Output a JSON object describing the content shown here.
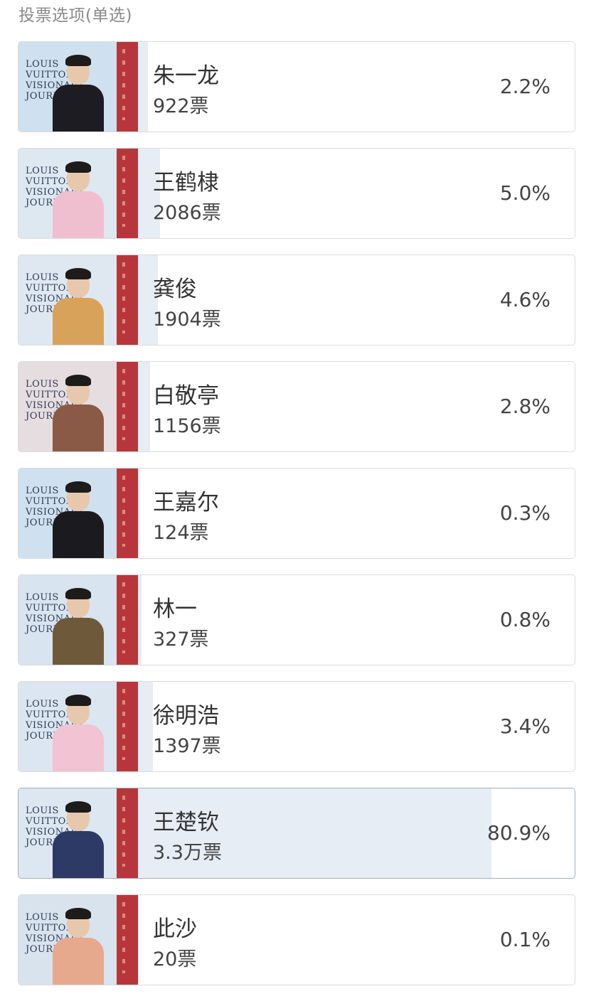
{
  "poll": {
    "header": "投票选项(单选)",
    "brand_text": "LOUIS VUITTON VISIONARY JOURNEYS",
    "options": [
      {
        "name": "朱一龙",
        "votes": "922票",
        "percent_label": "2.2%",
        "percent": 2.2,
        "jacket": "#1c1c22",
        "bg": "#cfe0ee"
      },
      {
        "name": "王鹤棣",
        "votes": "2086票",
        "percent_label": "5.0%",
        "percent": 5.0,
        "jacket": "#efbfd0",
        "bg": "#dde8f1"
      },
      {
        "name": "龚俊",
        "votes": "1904票",
        "percent_label": "4.6%",
        "percent": 4.6,
        "jacket": "#d9a25a",
        "bg": "#dfe8f1"
      },
      {
        "name": "白敬亭",
        "votes": "1156票",
        "percent_label": "2.8%",
        "percent": 2.8,
        "jacket": "#8a5a46",
        "bg": "#e6dde0"
      },
      {
        "name": "王嘉尔",
        "votes": "124票",
        "percent_label": "0.3%",
        "percent": 0.3,
        "jacket": "#1b1b1f",
        "bg": "#cfe1ef"
      },
      {
        "name": "林一",
        "votes": "327票",
        "percent_label": "0.8%",
        "percent": 0.8,
        "jacket": "#6e5a3a",
        "bg": "#d8e4ef"
      },
      {
        "name": "徐明浩",
        "votes": "1397票",
        "percent_label": "3.4%",
        "percent": 3.4,
        "jacket": "#f2c3d2",
        "bg": "#dbe6f1"
      },
      {
        "name": "王楚钦",
        "votes": "3.3万票",
        "percent_label": "80.9%",
        "percent": 80.9,
        "jacket": "#2e3a66",
        "bg": "#dce7f1",
        "selected": true
      },
      {
        "name": "此沙",
        "votes": "20票",
        "percent_label": "0.1%",
        "percent": 0.1,
        "jacket": "#e6a98d",
        "bg": "#d8e3ee"
      }
    ]
  },
  "colors": {
    "fill": "#e6edf4",
    "border": "#dcdcdc",
    "selected_border": "#9fb0be",
    "wall_red": "#b8363b"
  }
}
